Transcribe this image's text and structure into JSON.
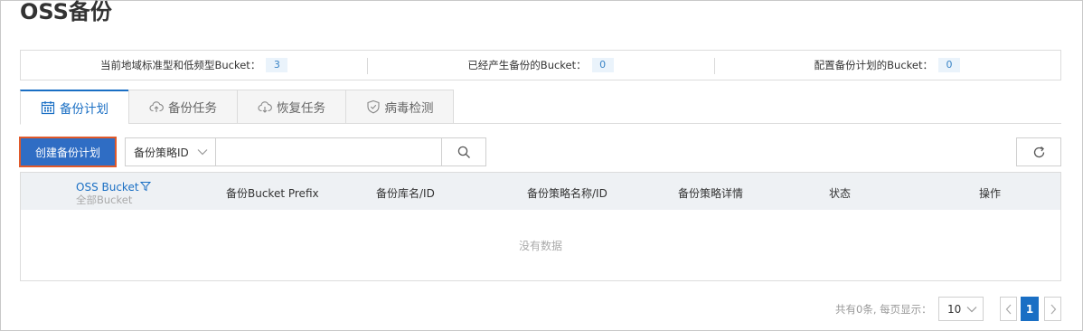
{
  "page": {
    "title": "OSS备份"
  },
  "stats": [
    {
      "label": "当前地域标准型和低频型Bucket：",
      "value": "3"
    },
    {
      "label": "已经产生备份的Bucket：",
      "value": "0"
    },
    {
      "label": "配置备份计划的Bucket：",
      "value": "0"
    }
  ],
  "tabs": [
    {
      "label": "备份计划",
      "icon": "calendar-icon",
      "active": true
    },
    {
      "label": "备份任务",
      "icon": "cloud-upload-icon",
      "active": false
    },
    {
      "label": "恢复任务",
      "icon": "cloud-download-icon",
      "active": false
    },
    {
      "label": "病毒检测",
      "icon": "shield-check-icon",
      "active": false
    }
  ],
  "toolbar": {
    "create_label": "创建备份计划",
    "filter_selected": "备份策略ID",
    "search_placeholder": "",
    "search_icon": "search-icon",
    "refresh_icon": "refresh-icon"
  },
  "table": {
    "columns": [
      {
        "label": "OSS Bucket",
        "sub": "全部Bucket",
        "icon": "filter-icon"
      },
      {
        "label": "备份Bucket Prefix"
      },
      {
        "label": "备份库名/ID"
      },
      {
        "label": "备份策略名称/ID"
      },
      {
        "label": "备份策略详情"
      },
      {
        "label": "状态"
      },
      {
        "label": "操作"
      }
    ],
    "empty_text": "没有数据"
  },
  "pagination": {
    "summary": "共有0条, 每页显示：",
    "page_size": "10",
    "current_page": "1"
  },
  "colors": {
    "accent": "#1a6fc4",
    "button": "#2f6dc4",
    "highlight_border": "#e0592a",
    "badge_bg": "#eaf3fb"
  }
}
